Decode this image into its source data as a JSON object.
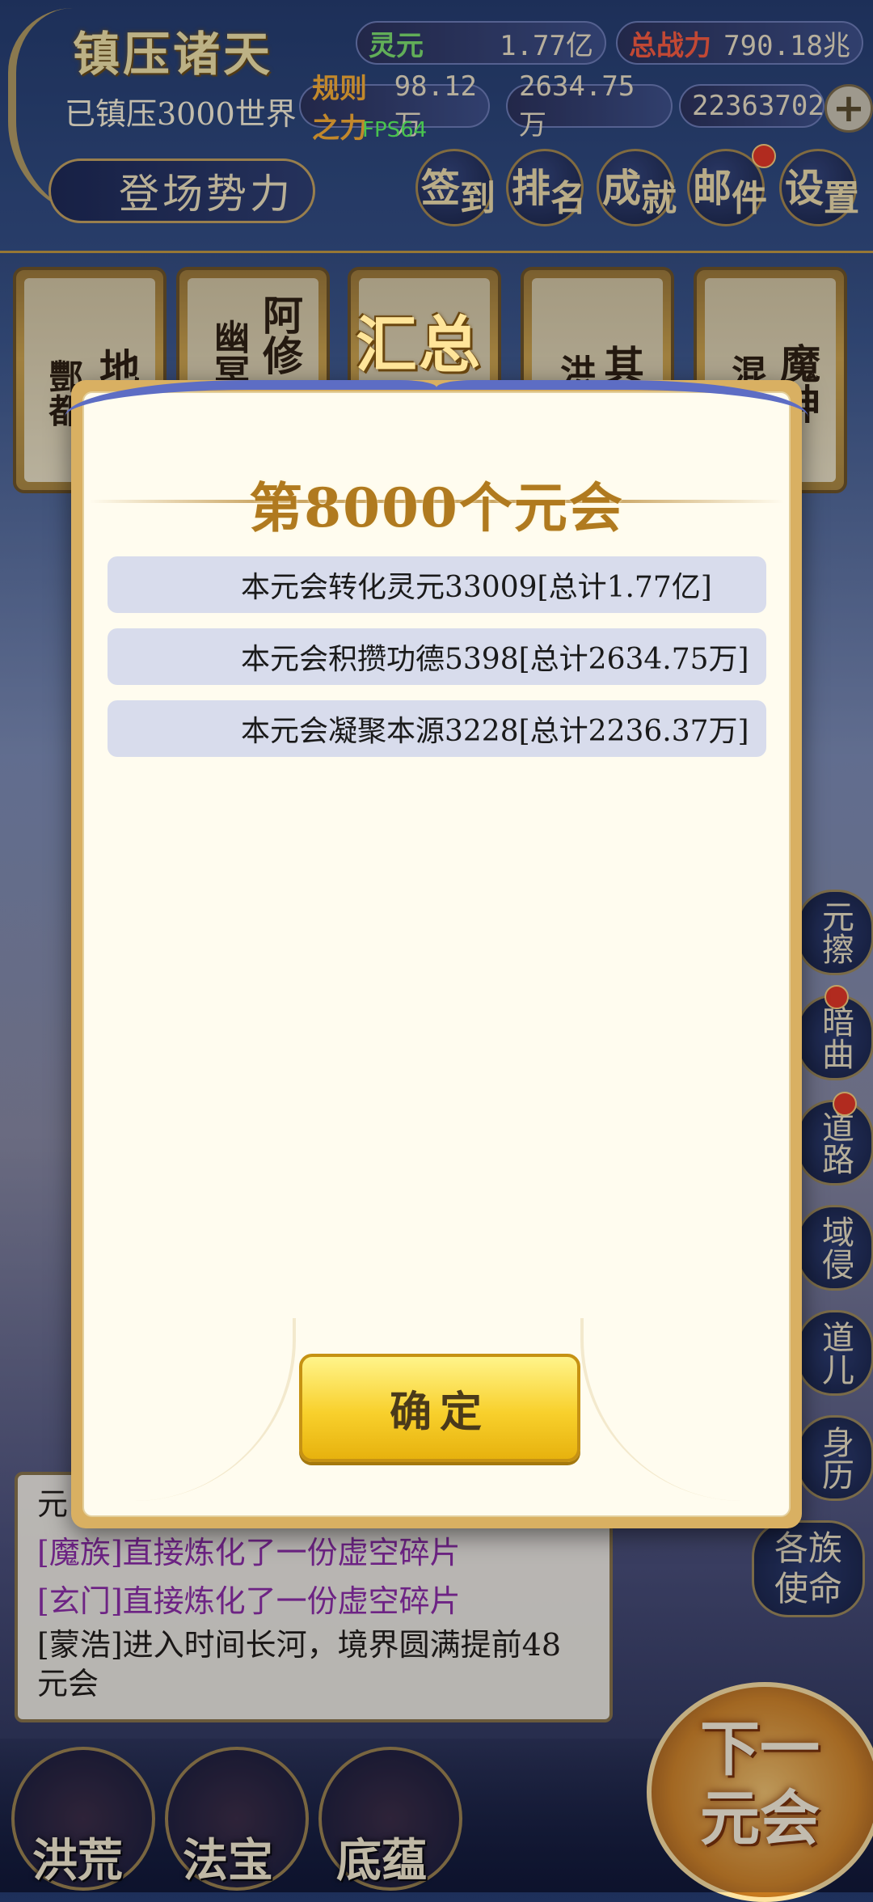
{
  "header": {
    "title": "镇压诸天",
    "world_status": "已镇压3000世界",
    "fps": "FPS64",
    "stats": [
      {
        "label": "灵元",
        "value": "1.77亿"
      },
      {
        "label": "总战力",
        "value": "790.18兆"
      },
      {
        "label": "规则之力",
        "value": "98.12万"
      },
      {
        "label": "",
        "value": "2634.75万"
      },
      {
        "label": "",
        "value": "22363702"
      }
    ],
    "plus_label": "+",
    "faction_button": "登场势力",
    "menu": [
      {
        "label": "签",
        "label2": "到"
      },
      {
        "label": "排",
        "label2": "名"
      },
      {
        "label": "成",
        "label2": "就"
      },
      {
        "label": "邮",
        "label2": "件"
      },
      {
        "label": "设",
        "label2": "置"
      }
    ]
  },
  "cards": [
    {
      "col1": "酆都",
      "col2": "地府"
    },
    {
      "col1": "幽冥",
      "col2": "阿修"
    },
    {
      "col1": "",
      "col2": ""
    },
    {
      "col1": "洪",
      "col2": "其"
    },
    {
      "col1": "混",
      "col2": "魔神"
    }
  ],
  "side_buttons": [
    "元擦",
    "暗曲",
    "道路",
    "域侵",
    "道儿",
    "身历",
    "各族使命"
  ],
  "log": {
    "first": "元",
    "entries": [
      {
        "tag": "[魔族]",
        "text": "直接炼化了一份虚空碎片"
      },
      {
        "tag": "[玄门]",
        "text": "直接炼化了一份虚空碎片"
      },
      {
        "tag": "[蒙浩]",
        "text": "进入时间长河，境界圆满提前48元会"
      }
    ]
  },
  "bottom_nav": [
    "洪荒",
    "法宝",
    "底蕴"
  ],
  "next_button": "下一元会",
  "dialog": {
    "tab": "汇总",
    "title": "第8000个元会",
    "rows": [
      "本元会转化灵元33009[总计1.77亿]",
      "本元会积攒功德5398[总计2634.75万]",
      "本元会凝聚本源3228[总计2236.37万]"
    ],
    "confirm": "确定"
  }
}
